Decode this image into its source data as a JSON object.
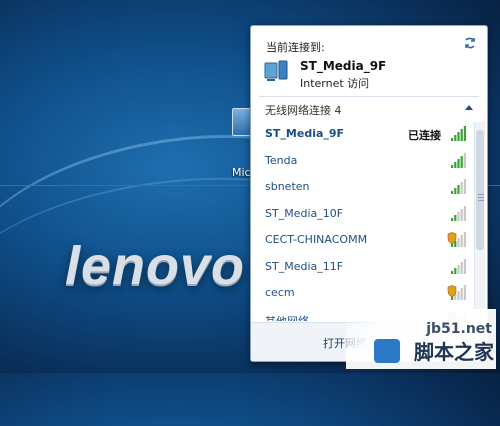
{
  "desktop": {
    "logo_text": "lenovo",
    "icon_label": "Mic"
  },
  "flyout": {
    "current_label": "当前连接到:",
    "current_network": {
      "name": "ST_Media_9F",
      "status": "Internet 访问"
    },
    "section_title": "无线网络连接 4",
    "networks": [
      {
        "name": "ST_Media_9F",
        "status": "已连接",
        "signal": 5,
        "secured": false,
        "connected": true
      },
      {
        "name": "Tenda",
        "status": "",
        "signal": 4,
        "secured": false,
        "connected": false
      },
      {
        "name": "sbneten",
        "status": "",
        "signal": 3,
        "secured": false,
        "connected": false
      },
      {
        "name": "ST_Media_10F",
        "status": "",
        "signal": 2,
        "secured": false,
        "connected": false
      },
      {
        "name": "CECT-CHINACOMM",
        "status": "",
        "signal": 2,
        "secured": true,
        "connected": false
      },
      {
        "name": "ST_Media_11F",
        "status": "",
        "signal": 2,
        "secured": false,
        "connected": false
      },
      {
        "name": "cecm",
        "status": "",
        "signal": 1,
        "secured": true,
        "connected": false
      },
      {
        "name": "其他网络",
        "status": "",
        "signal": 1,
        "secured": true,
        "connected": false
      }
    ],
    "footer_link": "打开网络"
  },
  "watermark": {
    "url": "jb51.net",
    "text": "脚本之家"
  },
  "colors": {
    "accent": "#1a4f86",
    "signal_good": "#3aa336",
    "signal_empty": "#c8c8c8",
    "shield": "#e0a020"
  }
}
